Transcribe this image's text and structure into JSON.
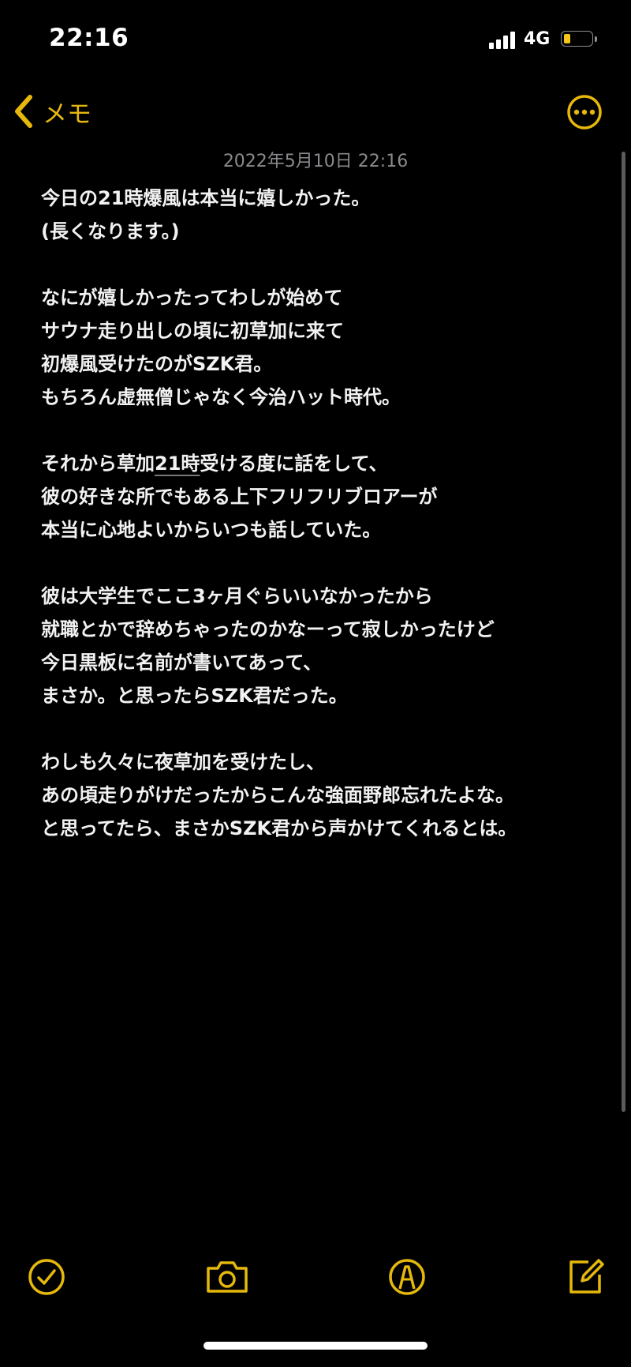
{
  "status_bar": {
    "time": "22:16",
    "network": "4G",
    "battery_level": 0.15
  },
  "nav": {
    "back_label": "メモ",
    "back_icon": "chevron-left-icon",
    "more_icon": "ellipsis-circle-icon"
  },
  "note": {
    "date": "2022年5月10日 22:16",
    "lines": [
      "今日の21時爆風は本当に嬉しかった。",
      "(長くなります。)",
      "",
      "なにが嬉しかったってわしが始めて",
      "サウナ走り出しの頃に初草加に来て",
      "初爆風受けたのがSZK君。",
      "もちろん虚無僧じゃなく今治ハット時代。",
      "",
      "それから草加21時受ける度に話をして、",
      "彼の好きな所でもある上下フリフリブロアーが",
      "本当に心地よいからいつも話していた。",
      "",
      "彼は大学生でここ3ヶ月ぐらいいなかったから",
      "就職とかで辞めちゃったのかなーって寂しかったけど",
      "今日黒板に名前が書いてあって、",
      "まさか。と思ったらSZK君だった。",
      "",
      "わしも久々に夜草加を受けたし、",
      "あの頃走りがけだったからこんな強面野郎忘れたよな。",
      "と思ってたら、まさかSZK君から声かけてくれるとは。"
    ],
    "underlined_word": "21時"
  },
  "toolbar": {
    "checklist_icon": "checklist-icon",
    "camera_icon": "camera-icon",
    "markup_icon": "markup-pen-icon",
    "compose_icon": "compose-icon"
  },
  "colors": {
    "accent": "#e5b80b",
    "background": "#000000",
    "text": "#f2f2f2",
    "secondary_text": "#8a8a8e"
  }
}
